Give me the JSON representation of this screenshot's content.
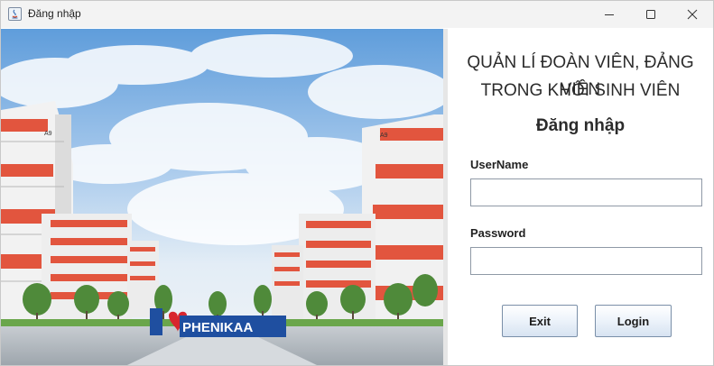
{
  "window": {
    "title": "Đăng nhập",
    "controls": {
      "minimize_icon": "minimize-icon",
      "maximize_icon": "maximize-icon",
      "close_icon": "close-icon"
    }
  },
  "banner": {
    "sign_text": "PHENIKAA",
    "building_label": "A9"
  },
  "form": {
    "app_title_line1": "QUẢN LÍ ĐOÀN VIÊN, ĐẢNG VIÊN",
    "app_title_line2": "TRONG KHỐI SINH VIÊN",
    "heading": "Đăng nhập",
    "username_label": "UserName",
    "username_value": "",
    "password_label": "Password",
    "password_value": "",
    "exit_label": "Exit",
    "login_label": "Login"
  },
  "colors": {
    "building_accent": "#e2553e",
    "sign_blue": "#1f4fa0",
    "heart_red": "#d8262e",
    "button_border": "#7a8fa8"
  }
}
